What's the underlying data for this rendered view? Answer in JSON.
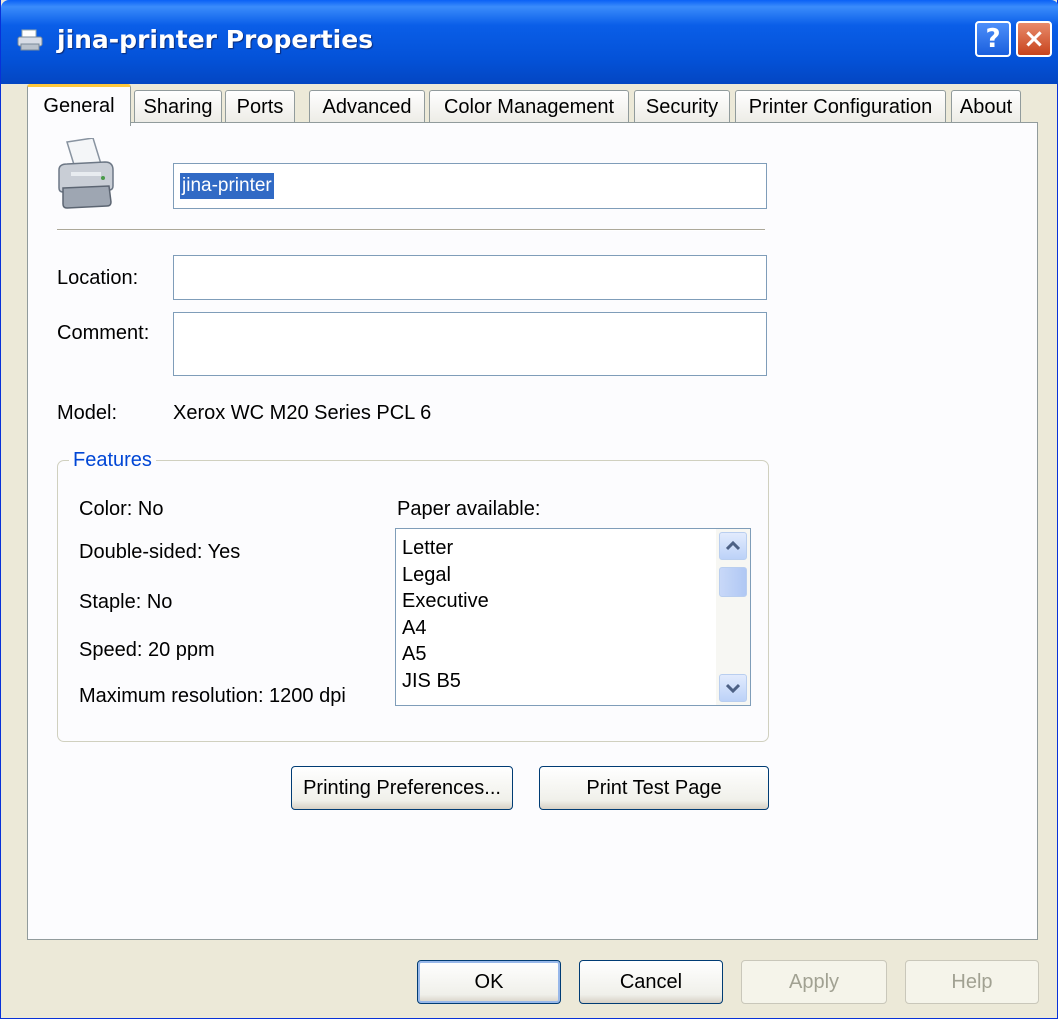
{
  "window": {
    "title": "jina-printer Properties",
    "help_glyph": "?",
    "close_glyph": "×"
  },
  "tabs": [
    {
      "label": "General",
      "active": true
    },
    {
      "label": "Sharing"
    },
    {
      "label": "Ports"
    },
    {
      "label": "Advanced"
    },
    {
      "label": "Color Management"
    },
    {
      "label": "Security"
    },
    {
      "label": "Printer Configuration"
    },
    {
      "label": "About"
    }
  ],
  "general": {
    "printer_name": "jina-printer",
    "location_label": "Location:",
    "location_value": "",
    "comment_label": "Comment:",
    "comment_value": "",
    "model_label": "Model:",
    "model_value": "Xerox WC M20 Series PCL 6"
  },
  "features": {
    "title": "Features",
    "color": "Color: No",
    "double_sided": "Double-sided: Yes",
    "staple": "Staple: No",
    "speed": "Speed: 20 ppm",
    "max_resolution": "Maximum resolution: 1200 dpi",
    "paper_label": "Paper available:",
    "paper_list": [
      "Letter",
      "Legal",
      "Executive",
      "A4",
      "A5",
      "JIS B5"
    ]
  },
  "buttons": {
    "printing_preferences": "Printing Preferences...",
    "print_test_page": "Print Test Page",
    "ok": "OK",
    "cancel": "Cancel",
    "apply": "Apply",
    "help": "Help"
  },
  "icons": {
    "title_icon": "printer-icon",
    "main_icon": "printer-icon",
    "scroll_up": "chevron-up-icon",
    "scroll_down": "chevron-down-icon"
  }
}
